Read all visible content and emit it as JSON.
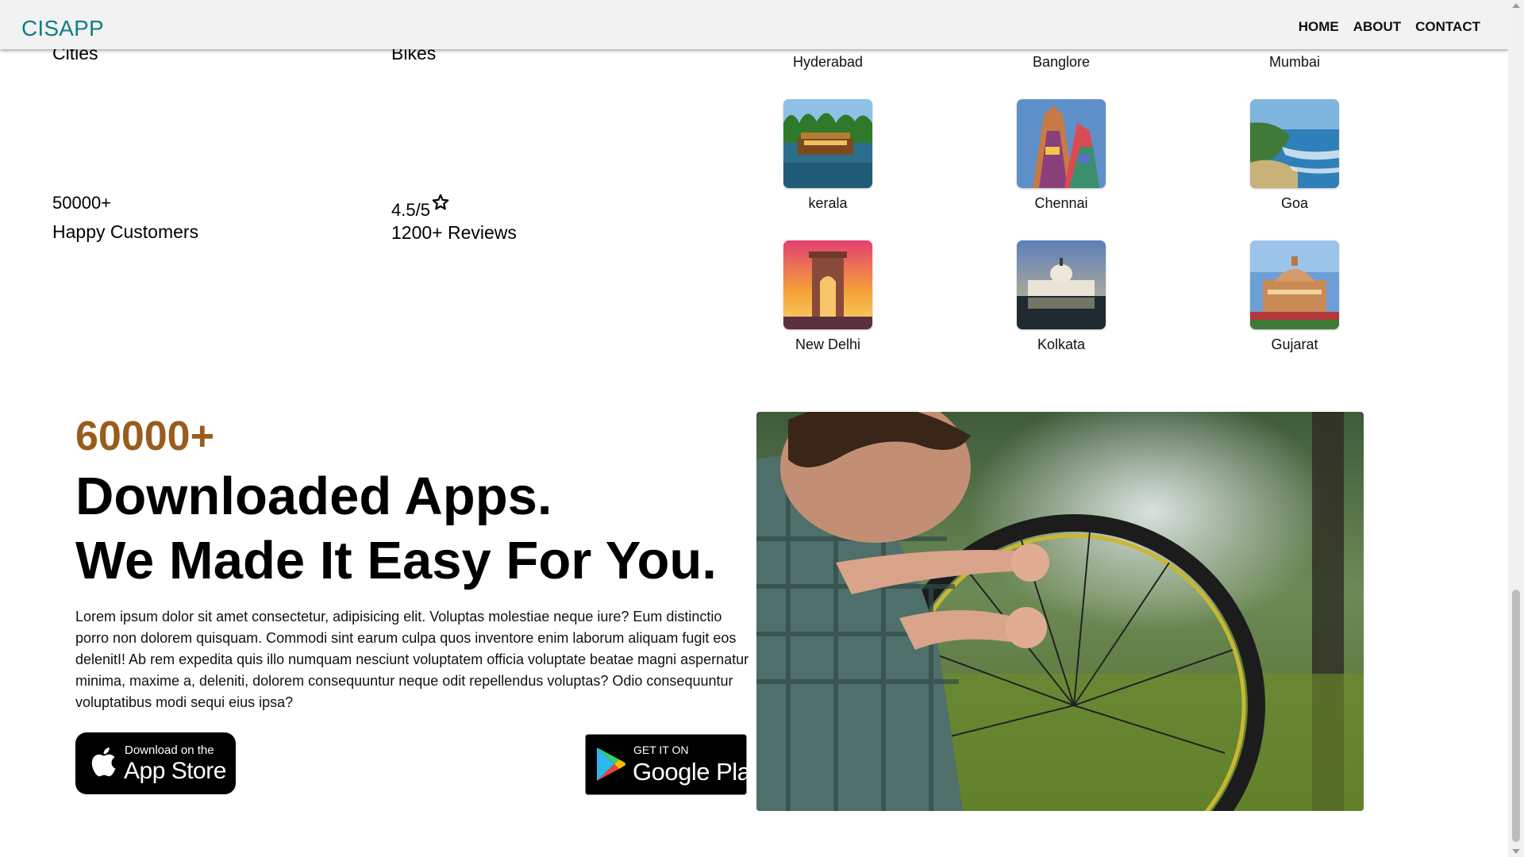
{
  "navbar": {
    "brand": "CISAPP",
    "links": [
      "HOME",
      "ABOUT",
      "CONTACT"
    ]
  },
  "stats": {
    "cities_label": "Cities",
    "bikes_label": "Bikes",
    "customers_value": "50000+",
    "customers_label": "Happy Customers",
    "rating_value": "4.5/5",
    "reviews_label": "1200+ Reviews"
  },
  "cities": {
    "top_row": [
      "Hyderabad",
      "Banglore",
      "Mumbai"
    ],
    "row2": [
      "kerala",
      "Chennai",
      "Goa"
    ],
    "row3": [
      "New Delhi",
      "Kolkata",
      "Gujarat"
    ]
  },
  "downloads": {
    "count": "60000+",
    "title_line1": "Downloaded Apps.",
    "title_line2": "We Made It Easy For You.",
    "description": "Lorem ipsum dolor sit amet consectetur, adipisicing elit. Voluptas molestiae neque iure? Eum distinctio porro non dolorem quisquam. Commodi sint earum culpa quos inventore enim laborum aliquam fugit eos delenitI! Ab rem expedita quis illo numquam nesciunt voluptatem officia voluptate beatae magni aspernatur minima, maxime a, deleniti, dolorem consequuntur neque odit repellendus voluptas? Odio consequuntur voluptatibus modi sequi eius ipsa?",
    "appstore_small": "Download on the",
    "appstore_big": "App Store",
    "googleplay_small": "GET IT ON",
    "googleplay_big": "Google Play"
  },
  "colors": {
    "brand": "#0f7f83",
    "accent_count": "#9a5c1c",
    "navbar_bg": "#f2f2f2"
  }
}
